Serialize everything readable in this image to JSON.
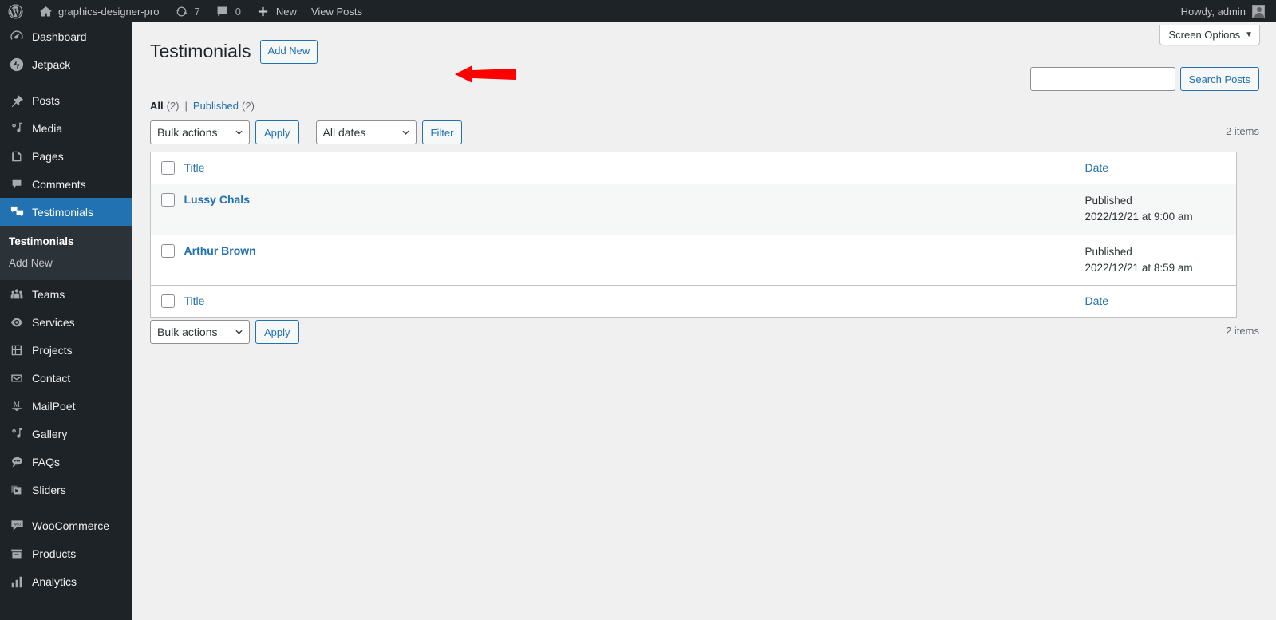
{
  "adminbar": {
    "site_name": "graphics-designer-pro",
    "updates_count": "7",
    "comments_count": "0",
    "new_label": "New",
    "view_posts_label": "View Posts",
    "howdy": "Howdy, admin"
  },
  "sidebar": {
    "items": [
      {
        "label": "Dashboard",
        "icon": "dashboard-icon",
        "current": false,
        "gap_before": false
      },
      {
        "label": "Jetpack",
        "icon": "jetpack-icon",
        "current": false,
        "gap_before": false
      },
      {
        "label": "Posts",
        "icon": "pin-icon",
        "current": false,
        "gap_before": true
      },
      {
        "label": "Media",
        "icon": "media-icon",
        "current": false,
        "gap_before": false
      },
      {
        "label": "Pages",
        "icon": "pages-icon",
        "current": false,
        "gap_before": false
      },
      {
        "label": "Comments",
        "icon": "comment-icon",
        "current": false,
        "gap_before": false
      },
      {
        "label": "Testimonials",
        "icon": "testimonials-icon",
        "current": true,
        "gap_before": false
      }
    ],
    "submenu": {
      "items": [
        {
          "label": "Testimonials",
          "current": true
        },
        {
          "label": "Add New",
          "current": false
        }
      ]
    },
    "items_after": [
      {
        "label": "Teams",
        "icon": "groups-icon",
        "gap_before": false
      },
      {
        "label": "Services",
        "icon": "visibility-icon",
        "gap_before": false
      },
      {
        "label": "Projects",
        "icon": "grid-icon",
        "gap_before": false
      },
      {
        "label": "Contact",
        "icon": "email-icon",
        "gap_before": false
      },
      {
        "label": "MailPoet",
        "icon": "mailpoet-icon",
        "gap_before": false
      },
      {
        "label": "Gallery",
        "icon": "media-icon",
        "gap_before": false
      },
      {
        "label": "FAQs",
        "icon": "faq-icon",
        "gap_before": false
      },
      {
        "label": "Sliders",
        "icon": "sliders-icon",
        "gap_before": false
      },
      {
        "label": "WooCommerce",
        "icon": "woocommerce-icon",
        "gap_before": true
      },
      {
        "label": "Products",
        "icon": "products-icon",
        "gap_before": false
      },
      {
        "label": "Analytics",
        "icon": "analytics-icon",
        "gap_before": false
      }
    ]
  },
  "screen_options": {
    "label": "Screen Options",
    "caret": "▼"
  },
  "page": {
    "title": "Testimonials",
    "add_new_label": "Add New"
  },
  "views": {
    "all_label": "All",
    "all_count": "(2)",
    "separator": "|",
    "published_label": "Published",
    "published_count": "(2)"
  },
  "search": {
    "value": "",
    "placeholder": "",
    "button_label": "Search Posts"
  },
  "tablenav_top": {
    "bulk_actions_label": "Bulk actions",
    "apply_label": "Apply",
    "dates_label": "All dates",
    "filter_label": "Filter",
    "items_count": "2 items"
  },
  "tablenav_bottom": {
    "bulk_actions_label": "Bulk actions",
    "apply_label": "Apply",
    "items_count": "2 items"
  },
  "table": {
    "columns": {
      "title": "Title",
      "date": "Date"
    },
    "rows": [
      {
        "title": "Lussy Chals",
        "date_status": "Published",
        "date_value": "2022/12/21 at 9:00 am"
      },
      {
        "title": "Arthur Brown",
        "date_status": "Published",
        "date_value": "2022/12/21 at 8:59 am"
      }
    ]
  },
  "annotation": {
    "type": "arrow-left",
    "color": "#ff0000",
    "points_to": "add-new-button"
  },
  "colors": {
    "sidebar_bg": "#1d2327",
    "submenu_bg": "#2c3338",
    "accent": "#2271b1",
    "content_bg": "#f0f0f1",
    "link": "#2271b1",
    "annotation_red": "#ff0000"
  }
}
